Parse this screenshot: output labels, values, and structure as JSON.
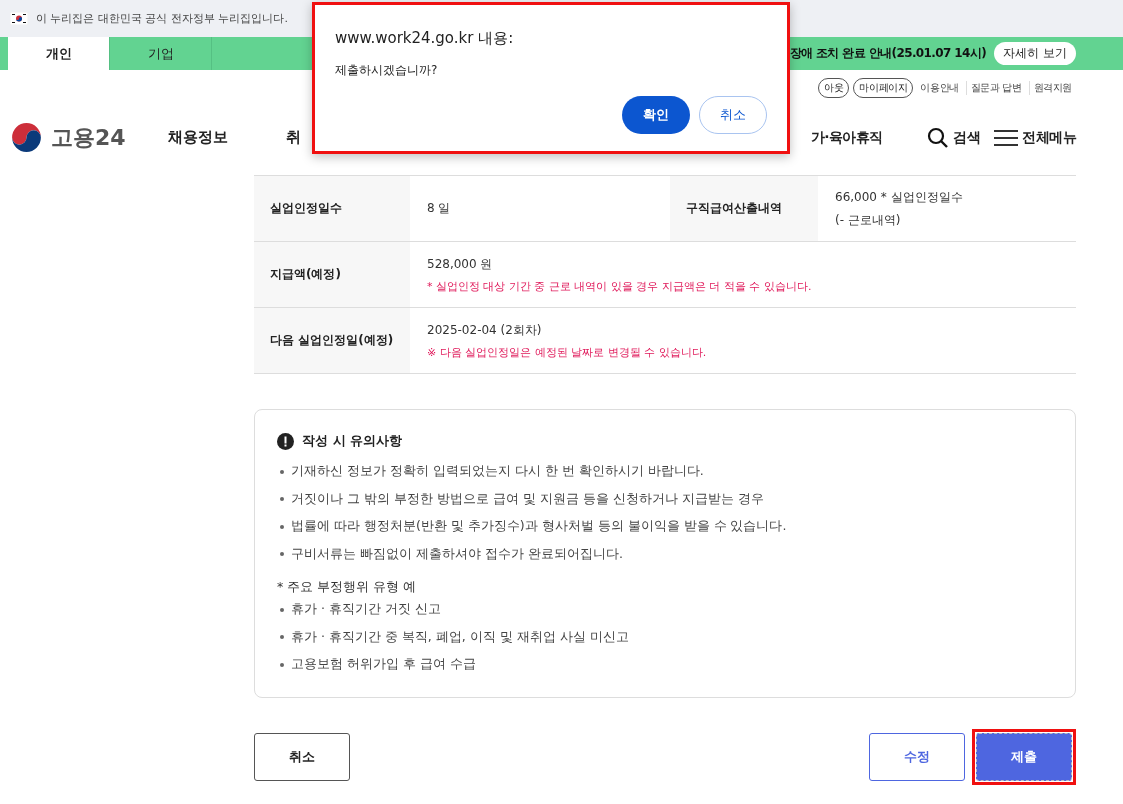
{
  "gov_banner": {
    "text": "이 누리집은 대한민국 공식 전자정부 누리집입니다."
  },
  "audience_tabs": [
    {
      "label": "개인",
      "selected": true
    },
    {
      "label": "기업",
      "selected": false
    }
  ],
  "notice_bar": {
    "text": "장애 조치 완료 안내(25.01.07 14시)",
    "button": "자세히 보기"
  },
  "utility_links": [
    {
      "label": "아웃",
      "kind": "pill"
    },
    {
      "label": "마이페이지",
      "kind": "pill"
    },
    {
      "label": "이용안내",
      "kind": "link"
    },
    {
      "label": "질문과 답변",
      "kind": "link"
    },
    {
      "label": "원격지원",
      "kind": "link"
    }
  ],
  "logo": {
    "text": "고용24"
  },
  "main_menu": [
    {
      "label": "채용정보",
      "kind": "left"
    },
    {
      "label": "취",
      "kind": "left"
    },
    {
      "label": "가·육아휴직",
      "kind": "right"
    }
  ],
  "header_actions": [
    {
      "label": "검색",
      "kind": "search"
    },
    {
      "label": "전체메뉴",
      "kind": "menu"
    }
  ],
  "summary_table": {
    "rows": [
      {
        "fields": [
          {
            "label": "실업인정일수",
            "lines": [
              {
                "text": "8 일",
                "kind": "plain"
              }
            ]
          },
          {
            "label": "구직급여산출내역",
            "lines": [
              {
                "text": "66,000 * 실업인정일수",
                "kind": "plain"
              },
              {
                "text": "(- 근로내역)",
                "kind": "plain"
              }
            ]
          }
        ]
      },
      {
        "fields": [
          {
            "label": "지급액(예정)",
            "lines": [
              {
                "text": "528,000 원",
                "kind": "plain"
              },
              {
                "text": "* 실업인정 대상 기간 중 근로 내역이 있을 경우 지급액은 더 적을 수 있습니다.",
                "kind": "note"
              }
            ]
          }
        ]
      },
      {
        "fields": [
          {
            "label": "다음 실업인정일(예정)",
            "lines": [
              {
                "text": "2025-02-04 (2회차)",
                "kind": "plain"
              },
              {
                "text": "※ 다음 실업인정일은 예정된 날짜로 변경될 수 있습니다.",
                "kind": "note"
              }
            ]
          }
        ]
      }
    ]
  },
  "notice_box": {
    "title": "작성 시 유의사항",
    "items": [
      {
        "kind": "bullet",
        "text": "기재하신 정보가 정확히 입력되었는지 다시 한 번 확인하시기 바랍니다."
      },
      {
        "kind": "bullet",
        "text": "거짓이나 그 밖의 부정한 방법으로 급여 및 지원금 등을 신청하거나 지급받는 경우"
      },
      {
        "kind": "bullet",
        "text": "법률에 따라 행정처분(반환 및 추가징수)과 형사처벌 등의 불이익을 받을 수 있습니다."
      },
      {
        "kind": "bullet",
        "text": "구비서류는 빠짐없이 제출하셔야 접수가 완료되어집니다."
      },
      {
        "kind": "heading",
        "text": "* 주요 부정행위 유형 예"
      },
      {
        "kind": "bullet",
        "text": "휴가 · 휴직기간 거짓 신고"
      },
      {
        "kind": "bullet",
        "text": "휴가 · 휴직기간 중 복직, 폐업, 이직 및 재취업 사실 미신고"
      },
      {
        "kind": "bullet",
        "text": "고용보험 허위가입 후 급여 수급"
      }
    ]
  },
  "buttons": [
    {
      "label": "취소",
      "kind": "outline",
      "highlighted": false
    },
    {
      "label": "수정",
      "kind": "secondary",
      "highlighted": false
    },
    {
      "label": "제출",
      "kind": "primary",
      "highlighted": true
    }
  ],
  "dialog": {
    "origin": "www.work24.go.kr 내용:",
    "message": "제출하시겠습니까?",
    "highlighted": true,
    "buttons": [
      {
        "label": "확인",
        "kind": "primary"
      },
      {
        "label": "취소",
        "kind": "secondary"
      }
    ]
  }
}
